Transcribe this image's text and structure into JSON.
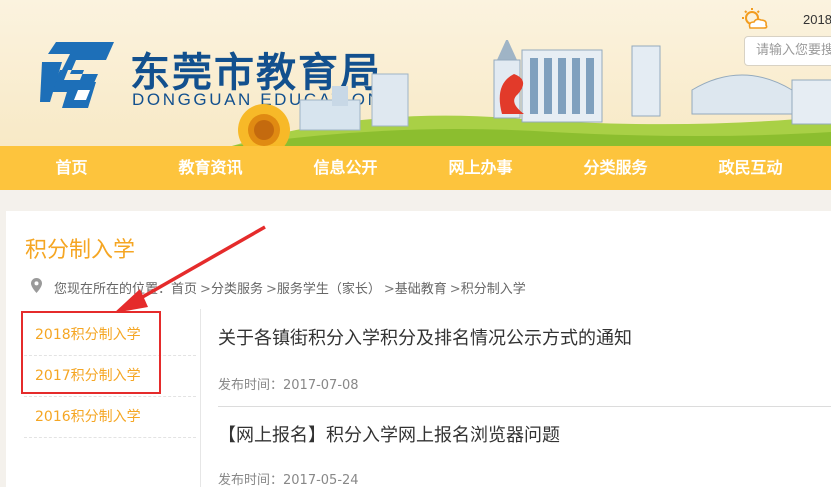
{
  "header": {
    "site_name_cn": "东莞市教育局",
    "site_name_en": "DONGGUAN EDUCATION",
    "date_text": "2018",
    "search_placeholder": "请输入您要搜索",
    "weather_icon": "sun-cloud-icon"
  },
  "nav": {
    "items": [
      {
        "label": "首页"
      },
      {
        "label": "教育资讯"
      },
      {
        "label": "信息公开"
      },
      {
        "label": "网上办事"
      },
      {
        "label": "分类服务"
      },
      {
        "label": "政民互动"
      }
    ]
  },
  "page": {
    "title": "积分制入学",
    "breadcrumb": {
      "prefix": "您现在所在的位置：",
      "items": [
        "首页",
        "分类服务",
        "服务学生（家长）",
        "基础教育",
        "积分制入学"
      ],
      "separator": ">"
    }
  },
  "sidebar": {
    "items": [
      {
        "label": "2018积分制入学"
      },
      {
        "label": "2017积分制入学"
      },
      {
        "label": "2016积分制入学"
      }
    ]
  },
  "news": {
    "date_prefix": "发布时间：",
    "items": [
      {
        "title": "关于各镇街积分入学积分及排名情况公示方式的通知",
        "date": "2017-07-08"
      },
      {
        "title": "【网上报名】积分入学网上报名浏览器问题",
        "date": "2017-05-24"
      }
    ]
  },
  "colors": {
    "brand_blue": "#12508e",
    "nav_yellow": "#fdc43d",
    "accent_orange": "#f5a623",
    "annotation_red": "#e52b2b"
  }
}
